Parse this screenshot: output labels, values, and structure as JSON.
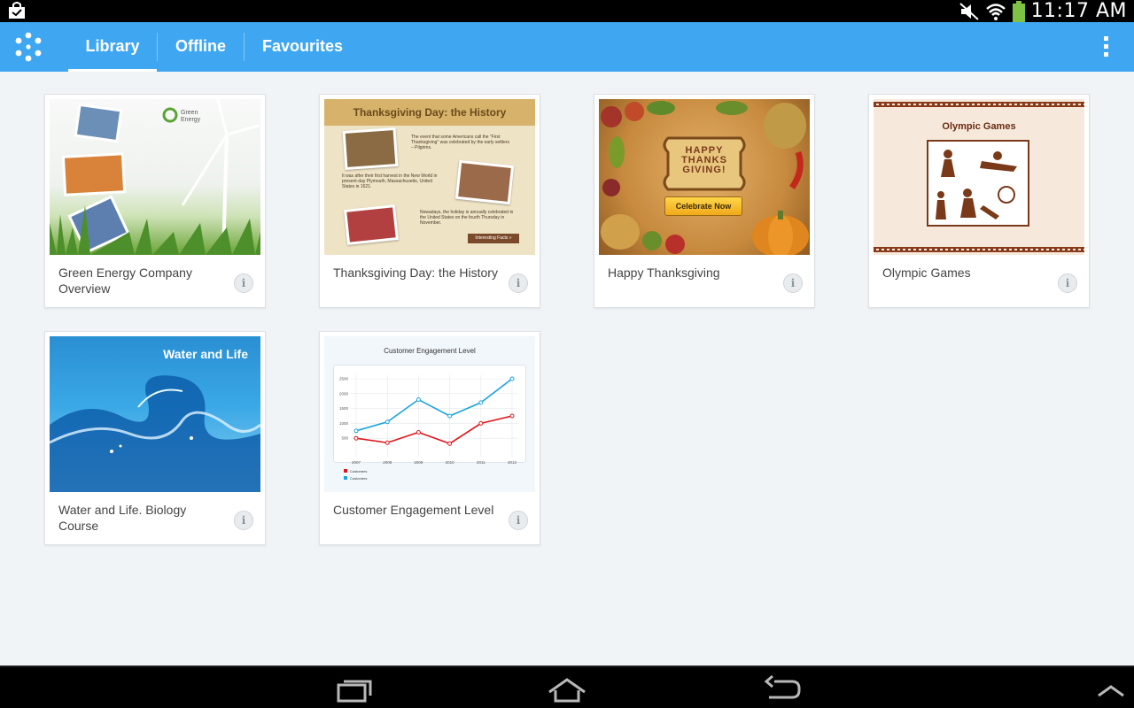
{
  "status_bar": {
    "time": "11:17 AM",
    "icons": [
      "shopping-bag-icon",
      "mute-icon",
      "wifi-icon",
      "battery-icon"
    ]
  },
  "app_bar": {
    "logo": "app-logo-icon",
    "tabs": [
      {
        "label": "Library",
        "active": true
      },
      {
        "label": "Offline",
        "active": false
      },
      {
        "label": "Favourites",
        "active": false
      }
    ],
    "menu_icon": "overflow-menu-icon"
  },
  "cards": [
    {
      "title": "Green Energy Company Overview",
      "thumb_text": "Green Energy"
    },
    {
      "title": "Thanksgiving Day: the History",
      "thumb_heading": "Thanksgiving Day: the History",
      "thumb_p1": "The event that some Americans call the \"First Thanksgiving\" was celebrated by the early settlers – Pilgrims.",
      "thumb_p2": "It was after their first harvest in the New World in present-day Plymouth, Massachusetts, United States in 1621.",
      "thumb_p3": "Nowadays, the holiday is annually celebrated in the United States on the fourth Thursday in November.",
      "thumb_btn": "Interesting Facts »"
    },
    {
      "title": "Happy Thanksgiving",
      "thumb_line1": "HAPPY",
      "thumb_line2": "THANKS",
      "thumb_line3": "GIVING!",
      "thumb_btn": "Celebrate Now"
    },
    {
      "title": "Olympic Games",
      "thumb_heading": "Olympic Games"
    },
    {
      "title": "Water and Life. Biology Course",
      "thumb_heading": "Water and Life"
    },
    {
      "title": "Customer Engagement Level"
    }
  ],
  "chart_data": {
    "type": "line",
    "title": "Customer Engagement Level",
    "categories": [
      "2007",
      "2008",
      "2009",
      "2010",
      "2011",
      "2012"
    ],
    "y_ticks": [
      "500",
      "1000",
      "1500",
      "2000",
      "2500"
    ],
    "ylim": [
      0,
      2500
    ],
    "series": [
      {
        "name": "Customers",
        "color": "#e0161b",
        "values": [
          500,
          350,
          700,
          320,
          1000,
          1250
        ]
      },
      {
        "name": "Customers",
        "color": "#1aa3e0",
        "values": [
          750,
          1050,
          1800,
          1250,
          1700,
          2500
        ]
      }
    ],
    "legend_position": "bottom-left",
    "grid": true
  },
  "nav_bar": {
    "icons": [
      "recent-apps-icon",
      "home-icon",
      "back-icon",
      "chevron-up-icon"
    ]
  },
  "colors": {
    "accent": "#3fa7f2",
    "background": "#f1f4f7"
  }
}
